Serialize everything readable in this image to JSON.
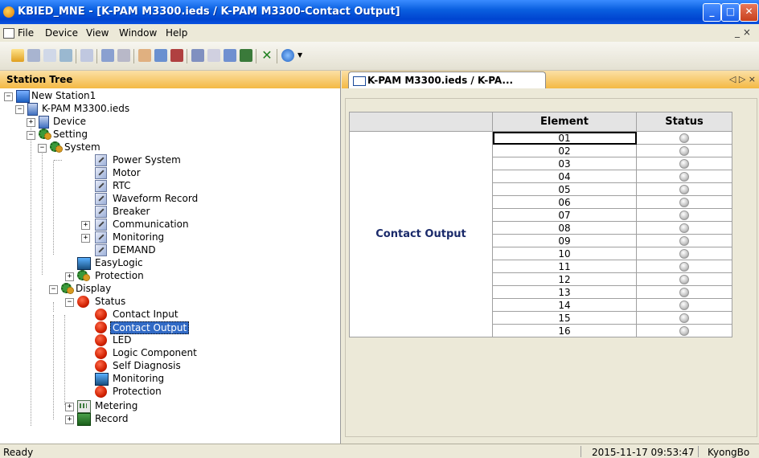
{
  "window": {
    "title": "KBIED_MNE - [K-PAM M3300.ieds / K-PAM M3300-Contact Output]",
    "mdi_controls": "_ ×"
  },
  "menu": [
    "File",
    "Device",
    "View",
    "Window",
    "Help"
  ],
  "left_panel": {
    "title": "Station Tree",
    "tree": {
      "station": "New Station1",
      "ied": "K-PAM M3300.ieds",
      "device": "Device",
      "setting": "Setting",
      "system": "System",
      "system_items": [
        "Power System",
        "Motor",
        "RTC",
        "Waveform Record",
        "Breaker",
        "Communication",
        "Monitoring",
        "DEMAND"
      ],
      "easylogic": "EasyLogic",
      "protection": "Protection",
      "display": "Display",
      "status": "Status",
      "status_items": [
        "Contact Input",
        "Contact Output",
        "LED",
        "Logic Component",
        "Self Diagnosis",
        "Monitoring",
        "Protection"
      ],
      "metering": "Metering",
      "record": "Record"
    }
  },
  "document": {
    "tab_label": "K-PAM M3300.ieds / K-PA...",
    "tab_nav": "◁ ▷ ×",
    "table": {
      "headers": [
        "Element",
        "Status"
      ],
      "group_label": "Contact Output",
      "elements": [
        "01",
        "02",
        "03",
        "04",
        "05",
        "06",
        "07",
        "08",
        "09",
        "10",
        "11",
        "12",
        "13",
        "14",
        "15",
        "16"
      ]
    }
  },
  "status_bar": {
    "text": "Ready",
    "datetime": "2015-11-17 09:53:47",
    "user": "KyongBo"
  }
}
